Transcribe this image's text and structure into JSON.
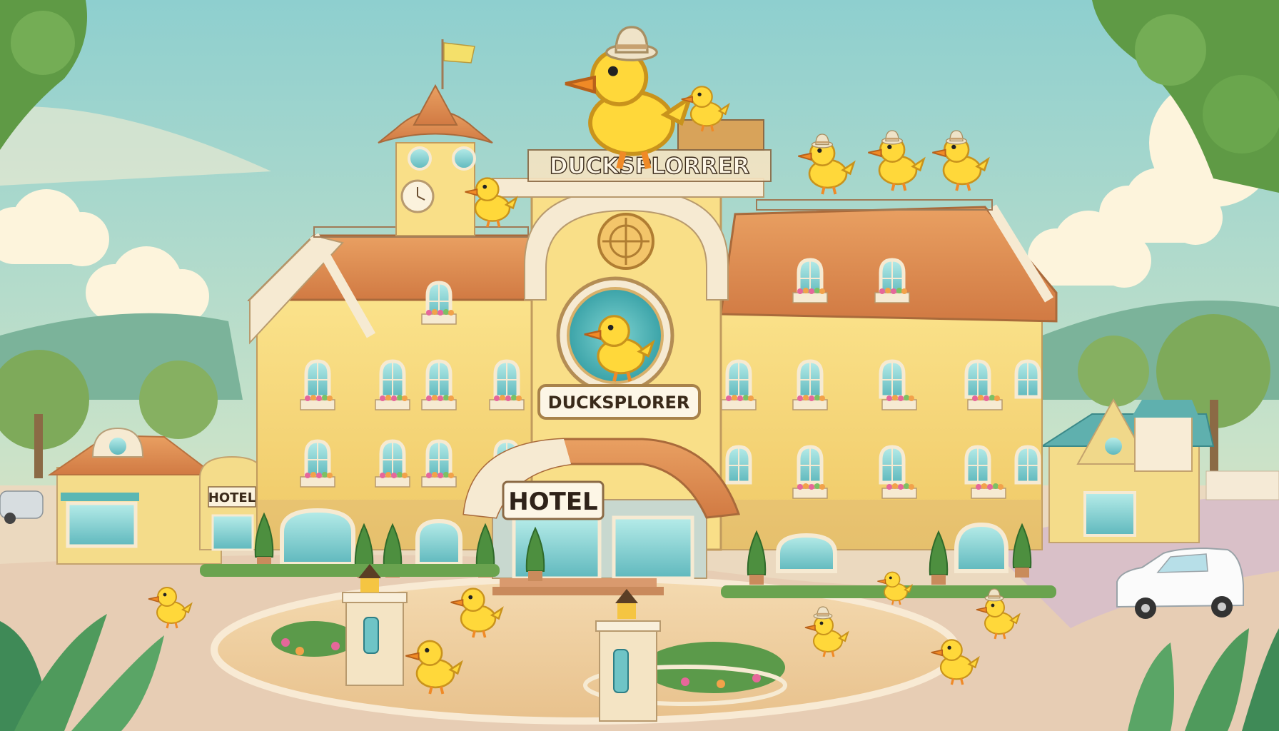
{
  "scene": {
    "rooftop_sign": "DUCKSPLORRER",
    "facade_sign": "DUCKSPLORER",
    "entrance_sign": "HOTEL",
    "annex_sign": "HOTEL"
  },
  "colors": {
    "sky": "#9fd3cf",
    "wall": "#f6d777",
    "roof": "#e28e56",
    "trim": "#f3e6cc",
    "duck": "#ffd83a",
    "beak": "#f08a26",
    "plaza": "#f1d2a6",
    "hedge": "#5b9a4a"
  }
}
